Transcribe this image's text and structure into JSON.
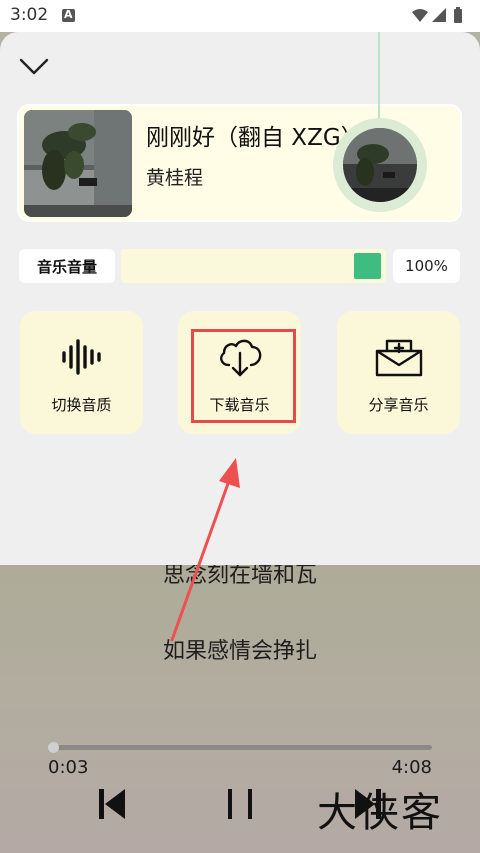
{
  "status_bar": {
    "time": "3:02",
    "indicator": "A"
  },
  "song": {
    "title": "刚刚好（翻自 XZG）",
    "artist": "黄桂程"
  },
  "volume": {
    "label": "音乐音量",
    "percent_text": "100%",
    "level": 1.0
  },
  "actions": [
    {
      "label": "切换音质",
      "icon": "sound-wave-icon"
    },
    {
      "label": "下载音乐",
      "icon": "cloud-download-icon"
    },
    {
      "label": "分享音乐",
      "icon": "share-mail-icon"
    }
  ],
  "lyrics": {
    "previous": "思念刻在墙和瓦",
    "current": "如果感情会挣扎"
  },
  "playback": {
    "elapsed": "0:03",
    "total": "4:08",
    "progress": 0.012
  },
  "watermark": "大侠客",
  "colors": {
    "accent_green": "#3fbd80",
    "highlight_red": "#e54a4a",
    "tile_bg": "#fbf8d9"
  }
}
